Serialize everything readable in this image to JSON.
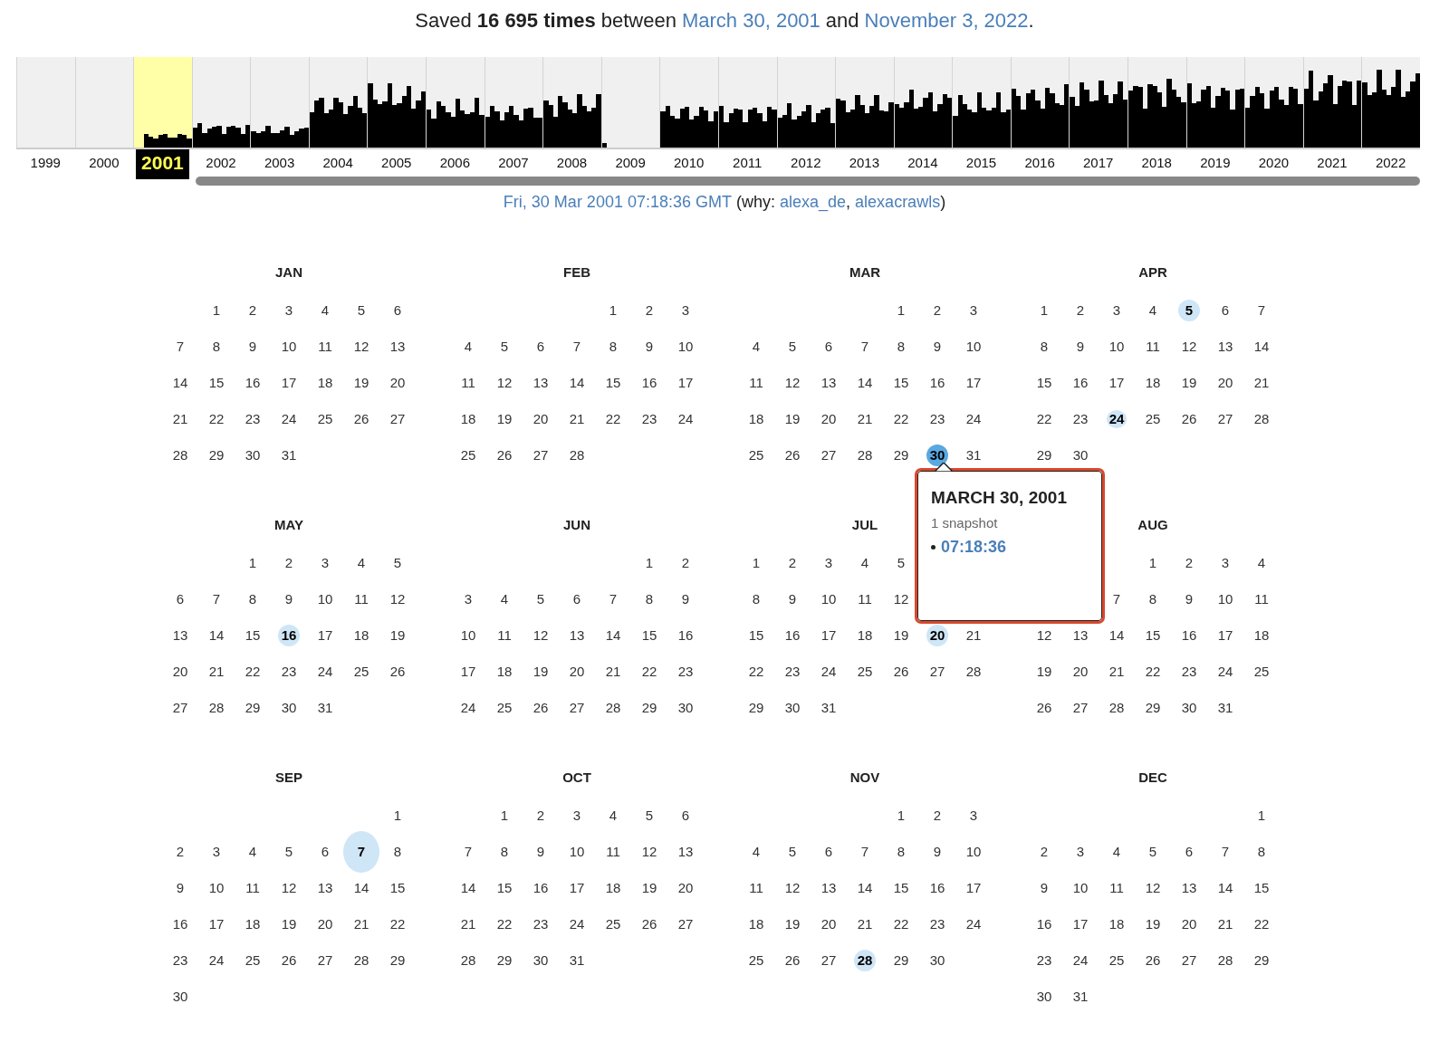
{
  "summary": {
    "text": "Saved **16 695 times** between",
    "first": "March 30, 2001",
    "middle": "and",
    "last": "November 3, 2022",
    "end": "."
  },
  "timeline": {
    "years": [
      {
        "label": "1999",
        "selected": false
      },
      {
        "label": "2000",
        "selected": false
      },
      {
        "label": "2001",
        "selected": true
      },
      {
        "label": "2002",
        "selected": false
      },
      {
        "label": "2003",
        "selected": false
      },
      {
        "label": "2004",
        "selected": false
      },
      {
        "label": "2005",
        "selected": false
      },
      {
        "label": "2006",
        "selected": false
      },
      {
        "label": "2007",
        "selected": false
      },
      {
        "label": "2008",
        "selected": false
      },
      {
        "label": "2009",
        "selected": false
      },
      {
        "label": "2010",
        "selected": false
      },
      {
        "label": "2011",
        "selected": false
      },
      {
        "label": "2012",
        "selected": false
      },
      {
        "label": "2013",
        "selected": false
      },
      {
        "label": "2014",
        "selected": false
      },
      {
        "label": "2015",
        "selected": false
      },
      {
        "label": "2016",
        "selected": false
      },
      {
        "label": "2017",
        "selected": false
      },
      {
        "label": "2018",
        "selected": false
      },
      {
        "label": "2019",
        "selected": false
      },
      {
        "label": "2020",
        "selected": false
      },
      {
        "label": "2021",
        "selected": false
      },
      {
        "label": "2022",
        "selected": false
      }
    ]
  },
  "capture_line": {
    "timestamp": "Fri, 30 Mar 2001 07:18:36 GMT",
    "why_open": "(why:",
    "reasons": [
      "alexa_de",
      "alexacrawls"
    ],
    "separator": ",",
    "why_close": ")"
  },
  "months": [
    {
      "name": "JAN",
      "weeks": [
        {
          "kind": "start",
          "days": [
            "1",
            "2",
            "3",
            "4",
            "5",
            "6"
          ]
        },
        {
          "kind": "full",
          "days": [
            "7",
            "8",
            "9",
            "10",
            "11",
            "12",
            "13"
          ]
        },
        {
          "kind": "full",
          "days": [
            "14",
            "15",
            "16",
            "17",
            "18",
            "19",
            "20"
          ]
        },
        {
          "kind": "full",
          "days": [
            "21",
            "22",
            "23",
            "24",
            "25",
            "26",
            "27"
          ]
        },
        {
          "kind": "end",
          "days": [
            "28",
            "29",
            "30",
            "31"
          ]
        }
      ]
    },
    {
      "name": "FEB",
      "weeks": [
        {
          "kind": "start",
          "days": [
            "1",
            "2",
            "3"
          ]
        },
        {
          "kind": "full",
          "days": [
            "4",
            "5",
            "6",
            "7",
            "8",
            "9",
            "10"
          ]
        },
        {
          "kind": "full",
          "days": [
            "11",
            "12",
            "13",
            "14",
            "15",
            "16",
            "17"
          ]
        },
        {
          "kind": "full",
          "days": [
            "18",
            "19",
            "20",
            "21",
            "22",
            "23",
            "24"
          ]
        },
        {
          "kind": "end",
          "days": [
            "25",
            "26",
            "27",
            "28"
          ]
        }
      ]
    },
    {
      "name": "MAR",
      "weeks": [
        {
          "kind": "start",
          "days": [
            "1",
            "2",
            "3"
          ]
        },
        {
          "kind": "full",
          "days": [
            "4",
            "5",
            "6",
            "7",
            "8",
            "9",
            "10"
          ]
        },
        {
          "kind": "full",
          "days": [
            "11",
            "12",
            "13",
            "14",
            "15",
            "16",
            "17"
          ]
        },
        {
          "kind": "full",
          "days": [
            "18",
            "19",
            "20",
            "21",
            "22",
            "23",
            "24"
          ]
        },
        {
          "kind": "full",
          "days": [
            "25",
            "26",
            "27",
            "28",
            "29",
            {
              "day": "30",
              "selected": true,
              "kind": "capture"
            },
            "31"
          ]
        }
      ]
    },
    {
      "name": "APR",
      "weeks": [
        {
          "kind": "full",
          "days": [
            "1",
            "2",
            "3",
            "4",
            {
              "day": "5",
              "selected": false,
              "kind": "capture"
            },
            "6",
            "7"
          ]
        },
        {
          "kind": "full",
          "days": [
            "8",
            "9",
            "10",
            "11",
            "12",
            "13",
            "14"
          ]
        },
        {
          "kind": "full",
          "days": [
            "15",
            "16",
            "17",
            "18",
            "19",
            "20",
            "21"
          ]
        },
        {
          "kind": "full",
          "days": [
            "22",
            "23",
            {
              "day": "24",
              "selected": false,
              "kind": "faint"
            },
            "25",
            "26",
            "27",
            "28"
          ]
        },
        {
          "kind": "end",
          "days": [
            "29",
            "30"
          ]
        }
      ]
    },
    {
      "name": "MAY",
      "weeks": [
        {
          "kind": "start",
          "days": [
            "1",
            "2",
            "3",
            "4",
            "5"
          ]
        },
        {
          "kind": "full",
          "days": [
            "6",
            "7",
            "8",
            "9",
            "10",
            "11",
            "12"
          ]
        },
        {
          "kind": "full",
          "days": [
            "13",
            "14",
            "15",
            {
              "day": "16",
              "selected": false,
              "kind": "capture"
            },
            "17",
            "18",
            "19"
          ]
        },
        {
          "kind": "full",
          "days": [
            "20",
            "21",
            "22",
            "23",
            "24",
            "25",
            "26"
          ]
        },
        {
          "kind": "end",
          "days": [
            "27",
            "28",
            "29",
            "30",
            "31"
          ]
        }
      ]
    },
    {
      "name": "JUN",
      "weeks": [
        {
          "kind": "start",
          "days": [
            "1",
            "2"
          ]
        },
        {
          "kind": "full",
          "days": [
            "3",
            "4",
            "5",
            "6",
            "7",
            "8",
            "9"
          ]
        },
        {
          "kind": "full",
          "days": [
            "10",
            "11",
            "12",
            "13",
            "14",
            "15",
            "16"
          ]
        },
        {
          "kind": "full",
          "days": [
            "17",
            "18",
            "19",
            "20",
            "21",
            "22",
            "23"
          ]
        },
        {
          "kind": "full",
          "days": [
            "24",
            "25",
            "26",
            "27",
            "28",
            "29",
            "30"
          ]
        }
      ]
    },
    {
      "name": "JUL",
      "weeks": [
        {
          "kind": "end",
          "days": [
            "1",
            "2",
            "3",
            "4",
            "5"
          ]
        },
        {
          "kind": "end",
          "days": [
            "8",
            "9",
            "10",
            "11",
            "12"
          ]
        },
        {
          "kind": "full",
          "days": [
            "15",
            "16",
            "17",
            "18",
            "19",
            {
              "day": "20",
              "selected": false,
              "kind": "capture"
            },
            "21"
          ]
        },
        {
          "kind": "full",
          "days": [
            "22",
            "23",
            "24",
            "25",
            "26",
            "27",
            "28"
          ]
        },
        {
          "kind": "end",
          "days": [
            "29",
            "30",
            "31"
          ]
        }
      ]
    },
    {
      "name": "AUG",
      "weeks": [
        {
          "kind": "start",
          "days": [
            "1",
            "2",
            "3",
            "4"
          ]
        },
        {
          "kind": "start",
          "days": [
            "7",
            "8",
            "9",
            "10",
            "11"
          ]
        },
        {
          "kind": "full",
          "days": [
            "12",
            "13",
            "14",
            "15",
            "16",
            "17",
            "18"
          ]
        },
        {
          "kind": "full",
          "days": [
            "19",
            "20",
            "21",
            "22",
            "23",
            "24",
            "25"
          ]
        },
        {
          "kind": "end",
          "days": [
            "26",
            "27",
            "28",
            "29",
            "30",
            "31"
          ]
        }
      ]
    },
    {
      "name": "SEP",
      "weeks": [
        {
          "kind": "start",
          "days": [
            "1"
          ]
        },
        {
          "kind": "full",
          "days": [
            "2",
            "3",
            "4",
            "5",
            "6",
            {
              "day": "7",
              "selected": false,
              "kind": "large"
            },
            "8"
          ]
        },
        {
          "kind": "full",
          "days": [
            "9",
            "10",
            "11",
            "12",
            "13",
            "14",
            "15"
          ]
        },
        {
          "kind": "full",
          "days": [
            "16",
            "17",
            "18",
            "19",
            "20",
            "21",
            "22"
          ]
        },
        {
          "kind": "full",
          "days": [
            "23",
            "24",
            "25",
            "26",
            "27",
            "28",
            "29"
          ]
        },
        {
          "kind": "end",
          "days": [
            "30"
          ]
        }
      ]
    },
    {
      "name": "OCT",
      "weeks": [
        {
          "kind": "start",
          "days": [
            "1",
            "2",
            "3",
            "4",
            "5",
            "6"
          ]
        },
        {
          "kind": "full",
          "days": [
            "7",
            "8",
            "9",
            "10",
            "11",
            "12",
            "13"
          ]
        },
        {
          "kind": "full",
          "days": [
            "14",
            "15",
            "16",
            "17",
            "18",
            "19",
            "20"
          ]
        },
        {
          "kind": "full",
          "days": [
            "21",
            "22",
            "23",
            "24",
            "25",
            "26",
            "27"
          ]
        },
        {
          "kind": "end",
          "days": [
            "28",
            "29",
            "30",
            "31"
          ]
        }
      ]
    },
    {
      "name": "NOV",
      "weeks": [
        {
          "kind": "start",
          "days": [
            "1",
            "2",
            "3"
          ]
        },
        {
          "kind": "full",
          "days": [
            "4",
            "5",
            "6",
            "7",
            "8",
            "9",
            "10"
          ]
        },
        {
          "kind": "full",
          "days": [
            "11",
            "12",
            "13",
            "14",
            "15",
            "16",
            "17"
          ]
        },
        {
          "kind": "full",
          "days": [
            "18",
            "19",
            "20",
            "21",
            "22",
            "23",
            "24"
          ]
        },
        {
          "kind": "end",
          "days": [
            "25",
            "26",
            "27",
            {
              "day": "28",
              "selected": false,
              "kind": "capture"
            },
            "29",
            "30"
          ]
        }
      ]
    },
    {
      "name": "DEC",
      "weeks": [
        {
          "kind": "start",
          "days": [
            "1"
          ]
        },
        {
          "kind": "full",
          "days": [
            "2",
            "3",
            "4",
            "5",
            "6",
            "7",
            "8"
          ]
        },
        {
          "kind": "full",
          "days": [
            "9",
            "10",
            "11",
            "12",
            "13",
            "14",
            "15"
          ]
        },
        {
          "kind": "full",
          "days": [
            "16",
            "17",
            "18",
            "19",
            "20",
            "21",
            "22"
          ]
        },
        {
          "kind": "full",
          "days": [
            "23",
            "24",
            "25",
            "26",
            "27",
            "28",
            "29"
          ]
        },
        {
          "kind": "end",
          "days": [
            "30",
            "31"
          ]
        }
      ]
    }
  ],
  "popup": {
    "title": "MARCH 30, 2001",
    "count": "1 snapshot",
    "times": [
      "07:18:36"
    ]
  }
}
